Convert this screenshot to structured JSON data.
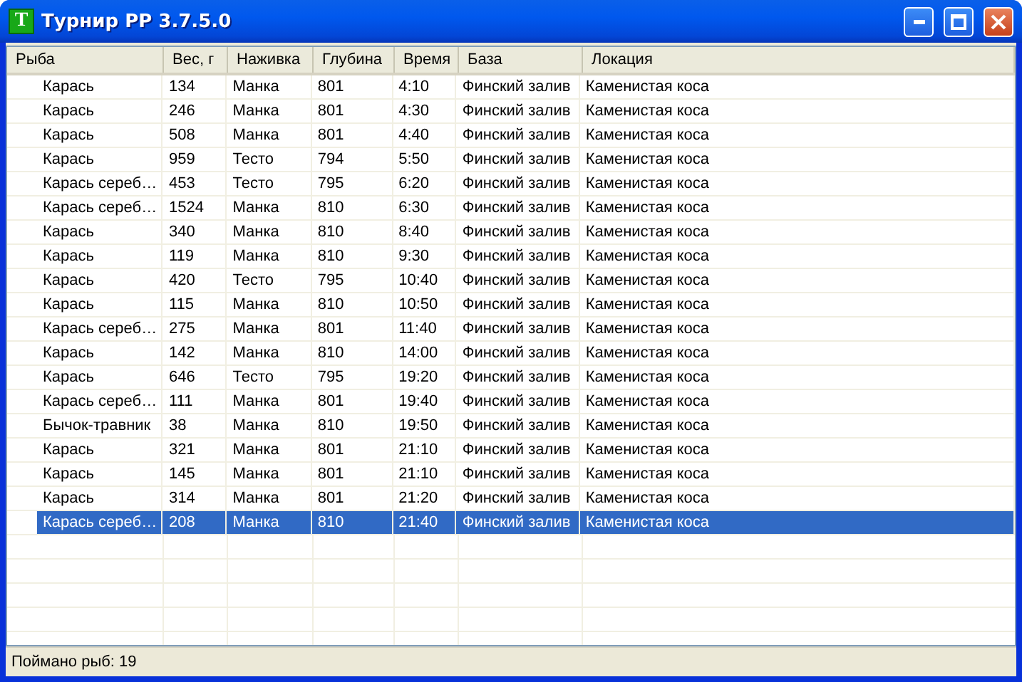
{
  "window": {
    "title": "Турнир РР 3.7.5.0",
    "icon_letter": "T"
  },
  "table": {
    "columns": [
      "Рыба",
      "Вес, г",
      "Наживка",
      "Глубина",
      "Время",
      "База",
      "Локация"
    ],
    "rows": [
      {
        "cells": [
          "Карась",
          "134",
          "Манка",
          "801",
          "4:10",
          "Финский залив",
          "Каменистая коса"
        ],
        "selected": false
      },
      {
        "cells": [
          "Карась",
          "246",
          "Манка",
          "801",
          "4:30",
          "Финский залив",
          "Каменистая коса"
        ],
        "selected": false
      },
      {
        "cells": [
          "Карась",
          "508",
          "Манка",
          "801",
          "4:40",
          "Финский залив",
          "Каменистая коса"
        ],
        "selected": false
      },
      {
        "cells": [
          "Карась",
          "959",
          "Тесто",
          "794",
          "5:50",
          "Финский залив",
          "Каменистая коса"
        ],
        "selected": false
      },
      {
        "cells": [
          "Карась сереб…",
          "453",
          "Тесто",
          "795",
          "6:20",
          "Финский залив",
          "Каменистая коса"
        ],
        "selected": false
      },
      {
        "cells": [
          "Карась сереб…",
          "1524",
          "Манка",
          "810",
          "6:30",
          "Финский залив",
          "Каменистая коса"
        ],
        "selected": false
      },
      {
        "cells": [
          "Карась",
          "340",
          "Манка",
          "810",
          "8:40",
          "Финский залив",
          "Каменистая коса"
        ],
        "selected": false
      },
      {
        "cells": [
          "Карась",
          "119",
          "Манка",
          "810",
          "9:30",
          "Финский залив",
          "Каменистая коса"
        ],
        "selected": false
      },
      {
        "cells": [
          "Карась",
          "420",
          "Тесто",
          "795",
          "10:40",
          "Финский залив",
          "Каменистая коса"
        ],
        "selected": false
      },
      {
        "cells": [
          "Карась",
          "115",
          "Манка",
          "810",
          "10:50",
          "Финский залив",
          "Каменистая коса"
        ],
        "selected": false
      },
      {
        "cells": [
          "Карась сереб…",
          "275",
          "Манка",
          "801",
          "11:40",
          "Финский залив",
          "Каменистая коса"
        ],
        "selected": false
      },
      {
        "cells": [
          "Карась",
          "142",
          "Манка",
          "810",
          "14:00",
          "Финский залив",
          "Каменистая коса"
        ],
        "selected": false
      },
      {
        "cells": [
          "Карась",
          "646",
          "Тесто",
          "795",
          "19:20",
          "Финский залив",
          "Каменистая коса"
        ],
        "selected": false
      },
      {
        "cells": [
          "Карась сереб…",
          "111",
          "Манка",
          "801",
          "19:40",
          "Финский залив",
          "Каменистая коса"
        ],
        "selected": false
      },
      {
        "cells": [
          "Бычок-травник",
          "38",
          "Манка",
          "810",
          "19:50",
          "Финский залив",
          "Каменистая коса"
        ],
        "selected": false
      },
      {
        "cells": [
          "Карась",
          "321",
          "Манка",
          "801",
          "21:10",
          "Финский залив",
          "Каменистая коса"
        ],
        "selected": false
      },
      {
        "cells": [
          "Карась",
          "145",
          "Манка",
          "801",
          "21:10",
          "Финский залив",
          "Каменистая коса"
        ],
        "selected": false
      },
      {
        "cells": [
          "Карась",
          "314",
          "Манка",
          "801",
          "21:20",
          "Финский залив",
          "Каменистая коса"
        ],
        "selected": false
      },
      {
        "cells": [
          "Карась сереб…",
          "208",
          "Манка",
          "810",
          "21:40",
          "Финский залив",
          "Каменистая коса"
        ],
        "selected": true
      }
    ]
  },
  "status_bar": "Поймано рыб: 19"
}
